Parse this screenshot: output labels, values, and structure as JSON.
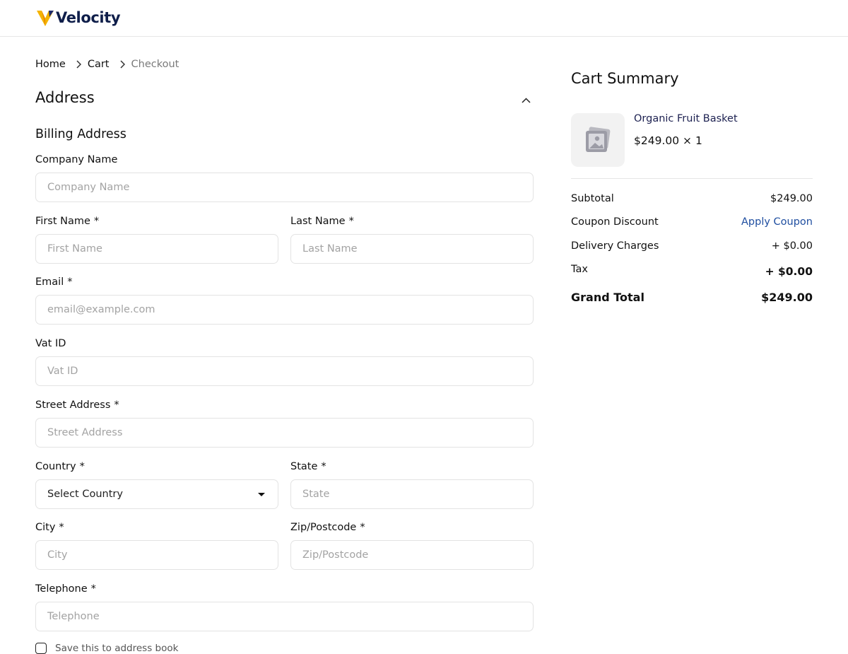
{
  "brand": {
    "name": "Velocity"
  },
  "breadcrumb": {
    "home": "Home",
    "cart": "Cart",
    "current": "Checkout"
  },
  "address_section": {
    "title": "Address",
    "subheading": "Billing Address"
  },
  "form": {
    "required_mark": "*",
    "company": {
      "label": "Company Name",
      "placeholder": "Company Name",
      "value": ""
    },
    "first_name": {
      "label": "First Name",
      "placeholder": "First Name",
      "value": ""
    },
    "last_name": {
      "label": "Last Name",
      "placeholder": "Last Name",
      "value": ""
    },
    "email": {
      "label": "Email",
      "placeholder": "email@example.com",
      "value": ""
    },
    "vat": {
      "label": "Vat ID",
      "placeholder": "Vat ID",
      "value": ""
    },
    "street": {
      "label": "Street Address",
      "placeholder": "Street Address",
      "value": ""
    },
    "country": {
      "label": "Country",
      "selected": "Select Country"
    },
    "state": {
      "label": "State",
      "placeholder": "State",
      "value": ""
    },
    "city": {
      "label": "City",
      "placeholder": "City",
      "value": ""
    },
    "zip": {
      "label": "Zip/Postcode",
      "placeholder": "Zip/Postcode",
      "value": ""
    },
    "telephone": {
      "label": "Telephone",
      "placeholder": "Telephone",
      "value": ""
    },
    "save_address": {
      "label": "Save this to address book",
      "checked": false
    }
  },
  "summary": {
    "title": "Cart Summary",
    "item": {
      "name": "Organic Fruit Basket",
      "price": "$249.00",
      "quantity": "× 1",
      "icon": "image-placeholder-icon"
    },
    "subtotal": {
      "label": "Subtotal",
      "value": "$249.00"
    },
    "coupon": {
      "label": "Coupon Discount",
      "value": "Apply Coupon"
    },
    "delivery": {
      "label": "Delivery Charges",
      "value": "+ $0.00"
    },
    "tax": {
      "label": "Tax",
      "value": "+ $0.00"
    },
    "grand_total": {
      "label": "Grand Total",
      "value": "$249.00"
    }
  },
  "colors": {
    "brand_navy": "#0f1e4a",
    "logo_yellow": "#f5b400",
    "logo_orange": "#e88a00",
    "link_blue": "#1f4ea0",
    "border": "#e3e3e3"
  }
}
